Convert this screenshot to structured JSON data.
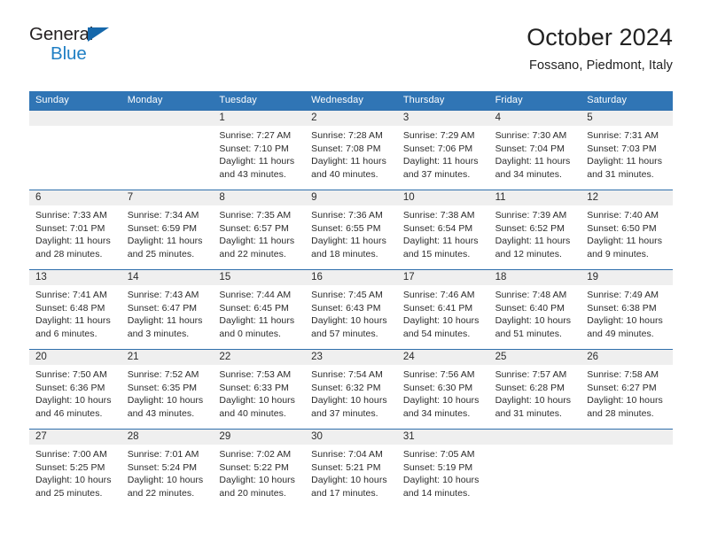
{
  "brand": {
    "name_top": "General",
    "name_bottom": "Blue",
    "accent_color": "#1668ab",
    "text_color": "#231f20"
  },
  "header": {
    "title": "October 2024",
    "subtitle": "Fossano, Piedmont, Italy"
  },
  "calendar": {
    "header_bg": "#3075b5",
    "cell_border": "#2f6fac",
    "daynum_band_bg": "#efefef",
    "weekdays": [
      "Sunday",
      "Monday",
      "Tuesday",
      "Wednesday",
      "Thursday",
      "Friday",
      "Saturday"
    ],
    "weeks": [
      [
        {
          "blank": true
        },
        {
          "blank": true
        },
        {
          "day": "1",
          "sunrise": "Sunrise: 7:27 AM",
          "sunset": "Sunset: 7:10 PM",
          "daylight1": "Daylight: 11 hours",
          "daylight2": "and 43 minutes."
        },
        {
          "day": "2",
          "sunrise": "Sunrise: 7:28 AM",
          "sunset": "Sunset: 7:08 PM",
          "daylight1": "Daylight: 11 hours",
          "daylight2": "and 40 minutes."
        },
        {
          "day": "3",
          "sunrise": "Sunrise: 7:29 AM",
          "sunset": "Sunset: 7:06 PM",
          "daylight1": "Daylight: 11 hours",
          "daylight2": "and 37 minutes."
        },
        {
          "day": "4",
          "sunrise": "Sunrise: 7:30 AM",
          "sunset": "Sunset: 7:04 PM",
          "daylight1": "Daylight: 11 hours",
          "daylight2": "and 34 minutes."
        },
        {
          "day": "5",
          "sunrise": "Sunrise: 7:31 AM",
          "sunset": "Sunset: 7:03 PM",
          "daylight1": "Daylight: 11 hours",
          "daylight2": "and 31 minutes."
        }
      ],
      [
        {
          "day": "6",
          "sunrise": "Sunrise: 7:33 AM",
          "sunset": "Sunset: 7:01 PM",
          "daylight1": "Daylight: 11 hours",
          "daylight2": "and 28 minutes."
        },
        {
          "day": "7",
          "sunrise": "Sunrise: 7:34 AM",
          "sunset": "Sunset: 6:59 PM",
          "daylight1": "Daylight: 11 hours",
          "daylight2": "and 25 minutes."
        },
        {
          "day": "8",
          "sunrise": "Sunrise: 7:35 AM",
          "sunset": "Sunset: 6:57 PM",
          "daylight1": "Daylight: 11 hours",
          "daylight2": "and 22 minutes."
        },
        {
          "day": "9",
          "sunrise": "Sunrise: 7:36 AM",
          "sunset": "Sunset: 6:55 PM",
          "daylight1": "Daylight: 11 hours",
          "daylight2": "and 18 minutes."
        },
        {
          "day": "10",
          "sunrise": "Sunrise: 7:38 AM",
          "sunset": "Sunset: 6:54 PM",
          "daylight1": "Daylight: 11 hours",
          "daylight2": "and 15 minutes."
        },
        {
          "day": "11",
          "sunrise": "Sunrise: 7:39 AM",
          "sunset": "Sunset: 6:52 PM",
          "daylight1": "Daylight: 11 hours",
          "daylight2": "and 12 minutes."
        },
        {
          "day": "12",
          "sunrise": "Sunrise: 7:40 AM",
          "sunset": "Sunset: 6:50 PM",
          "daylight1": "Daylight: 11 hours",
          "daylight2": "and 9 minutes."
        }
      ],
      [
        {
          "day": "13",
          "sunrise": "Sunrise: 7:41 AM",
          "sunset": "Sunset: 6:48 PM",
          "daylight1": "Daylight: 11 hours",
          "daylight2": "and 6 minutes."
        },
        {
          "day": "14",
          "sunrise": "Sunrise: 7:43 AM",
          "sunset": "Sunset: 6:47 PM",
          "daylight1": "Daylight: 11 hours",
          "daylight2": "and 3 minutes."
        },
        {
          "day": "15",
          "sunrise": "Sunrise: 7:44 AM",
          "sunset": "Sunset: 6:45 PM",
          "daylight1": "Daylight: 11 hours",
          "daylight2": "and 0 minutes."
        },
        {
          "day": "16",
          "sunrise": "Sunrise: 7:45 AM",
          "sunset": "Sunset: 6:43 PM",
          "daylight1": "Daylight: 10 hours",
          "daylight2": "and 57 minutes."
        },
        {
          "day": "17",
          "sunrise": "Sunrise: 7:46 AM",
          "sunset": "Sunset: 6:41 PM",
          "daylight1": "Daylight: 10 hours",
          "daylight2": "and 54 minutes."
        },
        {
          "day": "18",
          "sunrise": "Sunrise: 7:48 AM",
          "sunset": "Sunset: 6:40 PM",
          "daylight1": "Daylight: 10 hours",
          "daylight2": "and 51 minutes."
        },
        {
          "day": "19",
          "sunrise": "Sunrise: 7:49 AM",
          "sunset": "Sunset: 6:38 PM",
          "daylight1": "Daylight: 10 hours",
          "daylight2": "and 49 minutes."
        }
      ],
      [
        {
          "day": "20",
          "sunrise": "Sunrise: 7:50 AM",
          "sunset": "Sunset: 6:36 PM",
          "daylight1": "Daylight: 10 hours",
          "daylight2": "and 46 minutes."
        },
        {
          "day": "21",
          "sunrise": "Sunrise: 7:52 AM",
          "sunset": "Sunset: 6:35 PM",
          "daylight1": "Daylight: 10 hours",
          "daylight2": "and 43 minutes."
        },
        {
          "day": "22",
          "sunrise": "Sunrise: 7:53 AM",
          "sunset": "Sunset: 6:33 PM",
          "daylight1": "Daylight: 10 hours",
          "daylight2": "and 40 minutes."
        },
        {
          "day": "23",
          "sunrise": "Sunrise: 7:54 AM",
          "sunset": "Sunset: 6:32 PM",
          "daylight1": "Daylight: 10 hours",
          "daylight2": "and 37 minutes."
        },
        {
          "day": "24",
          "sunrise": "Sunrise: 7:56 AM",
          "sunset": "Sunset: 6:30 PM",
          "daylight1": "Daylight: 10 hours",
          "daylight2": "and 34 minutes."
        },
        {
          "day": "25",
          "sunrise": "Sunrise: 7:57 AM",
          "sunset": "Sunset: 6:28 PM",
          "daylight1": "Daylight: 10 hours",
          "daylight2": "and 31 minutes."
        },
        {
          "day": "26",
          "sunrise": "Sunrise: 7:58 AM",
          "sunset": "Sunset: 6:27 PM",
          "daylight1": "Daylight: 10 hours",
          "daylight2": "and 28 minutes."
        }
      ],
      [
        {
          "day": "27",
          "sunrise": "Sunrise: 7:00 AM",
          "sunset": "Sunset: 5:25 PM",
          "daylight1": "Daylight: 10 hours",
          "daylight2": "and 25 minutes."
        },
        {
          "day": "28",
          "sunrise": "Sunrise: 7:01 AM",
          "sunset": "Sunset: 5:24 PM",
          "daylight1": "Daylight: 10 hours",
          "daylight2": "and 22 minutes."
        },
        {
          "day": "29",
          "sunrise": "Sunrise: 7:02 AM",
          "sunset": "Sunset: 5:22 PM",
          "daylight1": "Daylight: 10 hours",
          "daylight2": "and 20 minutes."
        },
        {
          "day": "30",
          "sunrise": "Sunrise: 7:04 AM",
          "sunset": "Sunset: 5:21 PM",
          "daylight1": "Daylight: 10 hours",
          "daylight2": "and 17 minutes."
        },
        {
          "day": "31",
          "sunrise": "Sunrise: 7:05 AM",
          "sunset": "Sunset: 5:19 PM",
          "daylight1": "Daylight: 10 hours",
          "daylight2": "and 14 minutes."
        },
        {
          "blank": true
        },
        {
          "blank": true
        }
      ]
    ]
  }
}
